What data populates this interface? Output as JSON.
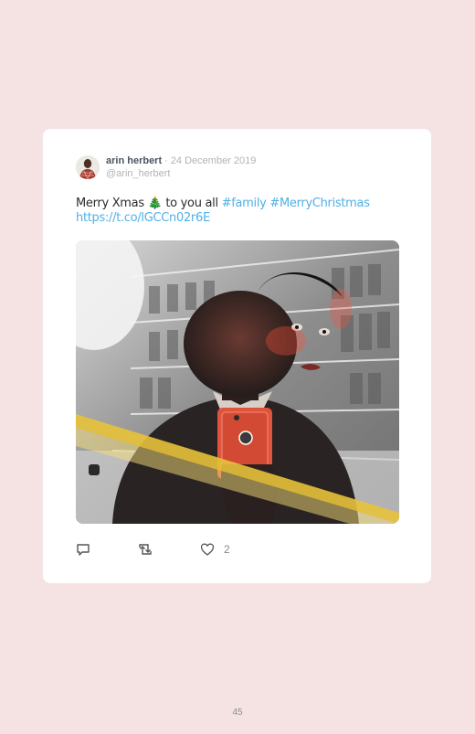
{
  "tweet": {
    "author_name": "arin herbert",
    "separator": "·",
    "date": "24 December 2019",
    "handle": "@arin_herbert",
    "text_before": "Merry Xmas ",
    "emoji": "🎄",
    "text_after": " to you all ",
    "hashtag_1": "#family",
    "hashtag_2": "#MerryChristmas",
    "link": "https://t.co/lGCCn02r6E",
    "like_count": "2"
  },
  "icons": {
    "reply": "reply-icon",
    "retweet": "retweet-icon",
    "like": "heart-icon"
  },
  "colors": {
    "page_background": "#f5e3e4",
    "card_background": "#ffffff",
    "link_color": "#4fb0e6",
    "name_color": "#4a5560",
    "meta_color": "#b3b3b3"
  },
  "footer": {
    "page_number": "45"
  }
}
